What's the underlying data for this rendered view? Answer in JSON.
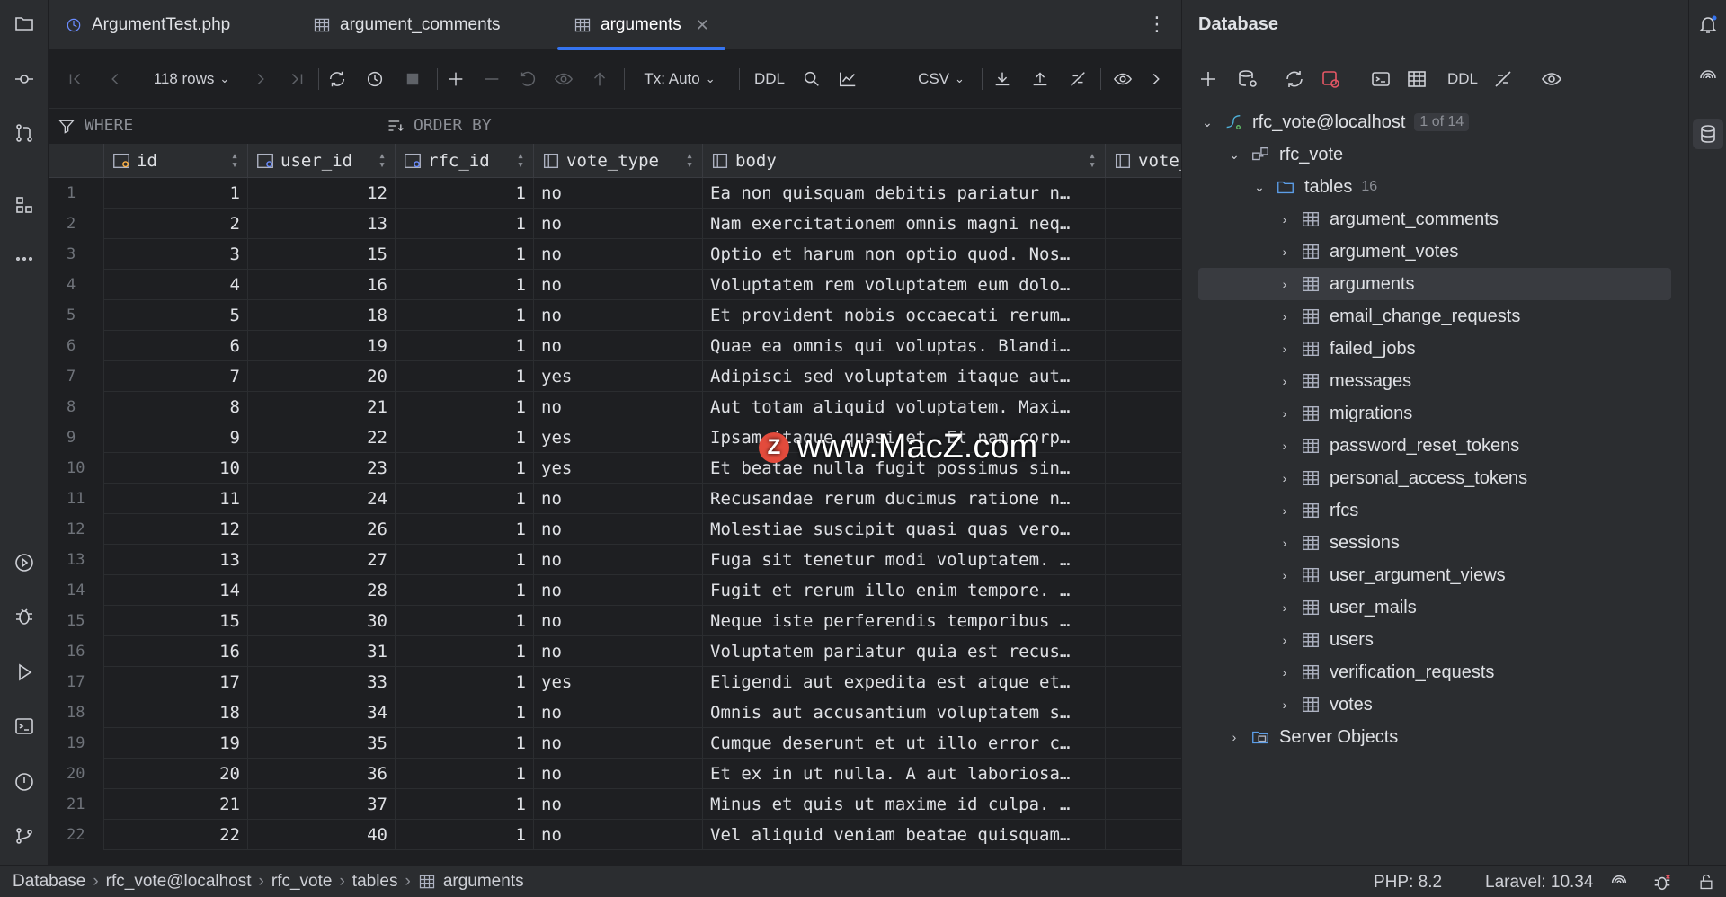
{
  "tabs": [
    {
      "label": "ArgumentTest.php",
      "icon": "php-file-icon"
    },
    {
      "label": "argument_comments",
      "icon": "table-icon"
    },
    {
      "label": "arguments",
      "icon": "table-icon",
      "active": true
    }
  ],
  "toolbar": {
    "rows_label": "118 rows",
    "tx_label": "Tx: Auto",
    "ddl_label": "DDL",
    "csv_label": "CSV"
  },
  "filter": {
    "where_label": "WHERE",
    "order_label": "ORDER BY"
  },
  "grid": {
    "columns": [
      "id",
      "user_id",
      "rfc_id",
      "vote_type",
      "body",
      "vote_cour"
    ],
    "rows": [
      {
        "n": "1",
        "id": "1",
        "user_id": "12",
        "rfc_id": "1",
        "vote_type": "no",
        "body": "Ea non quisquam debitis pariatur n…"
      },
      {
        "n": "2",
        "id": "2",
        "user_id": "13",
        "rfc_id": "1",
        "vote_type": "no",
        "body": "Nam exercitationem omnis magni neq…"
      },
      {
        "n": "3",
        "id": "3",
        "user_id": "15",
        "rfc_id": "1",
        "vote_type": "no",
        "body": "Optio et harum non optio quod. Nos…"
      },
      {
        "n": "4",
        "id": "4",
        "user_id": "16",
        "rfc_id": "1",
        "vote_type": "no",
        "body": "Voluptatem rem voluptatem eum dolo…"
      },
      {
        "n": "5",
        "id": "5",
        "user_id": "18",
        "rfc_id": "1",
        "vote_type": "no",
        "body": "Et provident nobis occaecati rerum…"
      },
      {
        "n": "6",
        "id": "6",
        "user_id": "19",
        "rfc_id": "1",
        "vote_type": "no",
        "body": "Quae ea omnis qui voluptas. Blandi…"
      },
      {
        "n": "7",
        "id": "7",
        "user_id": "20",
        "rfc_id": "1",
        "vote_type": "yes",
        "body": "Adipisci sed voluptatem itaque aut…"
      },
      {
        "n": "8",
        "id": "8",
        "user_id": "21",
        "rfc_id": "1",
        "vote_type": "no",
        "body": "Aut totam aliquid voluptatem. Maxi…"
      },
      {
        "n": "9",
        "id": "9",
        "user_id": "22",
        "rfc_id": "1",
        "vote_type": "yes",
        "body": "Ipsam itaque quasi et. Et nam corp…"
      },
      {
        "n": "10",
        "id": "10",
        "user_id": "23",
        "rfc_id": "1",
        "vote_type": "yes",
        "body": "Et beatae nulla fugit possimus sin…"
      },
      {
        "n": "11",
        "id": "11",
        "user_id": "24",
        "rfc_id": "1",
        "vote_type": "no",
        "body": "Recusandae rerum ducimus ratione n…"
      },
      {
        "n": "12",
        "id": "12",
        "user_id": "26",
        "rfc_id": "1",
        "vote_type": "no",
        "body": "Molestiae suscipit quasi quas vero…"
      },
      {
        "n": "13",
        "id": "13",
        "user_id": "27",
        "rfc_id": "1",
        "vote_type": "no",
        "body": "Fuga sit tenetur modi voluptatem. …"
      },
      {
        "n": "14",
        "id": "14",
        "user_id": "28",
        "rfc_id": "1",
        "vote_type": "no",
        "body": "Fugit et rerum illo enim tempore. …"
      },
      {
        "n": "15",
        "id": "15",
        "user_id": "30",
        "rfc_id": "1",
        "vote_type": "no",
        "body": "Neque iste perferendis temporibus …"
      },
      {
        "n": "16",
        "id": "16",
        "user_id": "31",
        "rfc_id": "1",
        "vote_type": "no",
        "body": "Voluptatem pariatur quia est recus…"
      },
      {
        "n": "17",
        "id": "17",
        "user_id": "33",
        "rfc_id": "1",
        "vote_type": "yes",
        "body": "Eligendi aut expedita est atque et…"
      },
      {
        "n": "18",
        "id": "18",
        "user_id": "34",
        "rfc_id": "1",
        "vote_type": "no",
        "body": "Omnis aut accusantium voluptatem s…"
      },
      {
        "n": "19",
        "id": "19",
        "user_id": "35",
        "rfc_id": "1",
        "vote_type": "no",
        "body": "Cumque deserunt et ut illo error c…"
      },
      {
        "n": "20",
        "id": "20",
        "user_id": "36",
        "rfc_id": "1",
        "vote_type": "no",
        "body": "Et ex in ut nulla. A aut laboriosa…"
      },
      {
        "n": "21",
        "id": "21",
        "user_id": "37",
        "rfc_id": "1",
        "vote_type": "no",
        "body": "Minus et quis ut maxime id culpa. …"
      },
      {
        "n": "22",
        "id": "22",
        "user_id": "40",
        "rfc_id": "1",
        "vote_type": "no",
        "body": "Vel aliquid veniam beatae quisquam…"
      }
    ]
  },
  "watermark": {
    "text": "www.MacZ.com",
    "logo_letter": "Z"
  },
  "database": {
    "title": "Database",
    "ddl_label": "DDL",
    "connection": "rfc_vote@localhost",
    "connection_badge": "1 of 14",
    "schema": "rfc_vote",
    "tables_label": "tables",
    "tables_count": "16",
    "tables": [
      "argument_comments",
      "argument_votes",
      "arguments",
      "email_change_requests",
      "failed_jobs",
      "messages",
      "migrations",
      "password_reset_tokens",
      "personal_access_tokens",
      "rfcs",
      "sessions",
      "user_argument_views",
      "user_mails",
      "users",
      "verification_requests",
      "votes"
    ],
    "selected_table": "arguments",
    "server_objects": "Server Objects"
  },
  "statusbar": {
    "crumbs": [
      "Database",
      "rfc_vote@localhost",
      "rfc_vote",
      "tables",
      "arguments"
    ],
    "php": "PHP: 8.2",
    "laravel": "Laravel: 10.34"
  },
  "colors": {
    "accent": "#3574f0",
    "background": "#1e1f22",
    "panel": "#2b2d30"
  }
}
